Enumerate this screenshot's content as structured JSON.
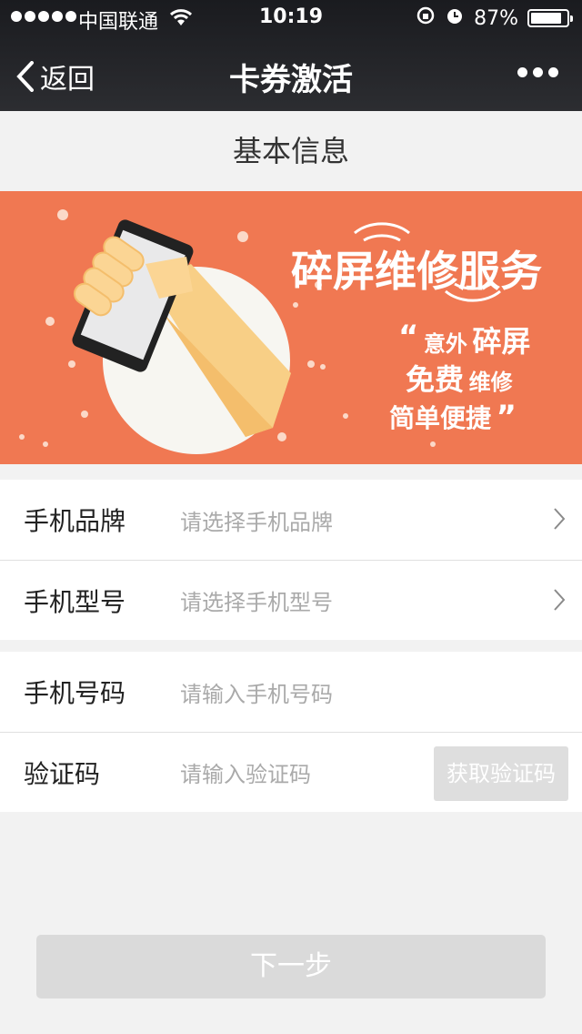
{
  "status_bar": {
    "carrier": "中国联通",
    "time": "10:19",
    "battery": "87%",
    "battery_level": 0.87
  },
  "nav": {
    "back_label": "返回",
    "title": "卡券激活"
  },
  "section_title": "基本信息",
  "banner": {
    "headline": "碎屏维修服务",
    "line1_a": "意外",
    "line1_b": "碎屏",
    "line2_a": "免费",
    "line2_b": "维修",
    "line3": "简单便捷",
    "accent_color": "#f07852"
  },
  "form": {
    "brand": {
      "label": "手机品牌",
      "placeholder": "请选择手机品牌"
    },
    "model": {
      "label": "手机型号",
      "placeholder": "请选择手机型号"
    },
    "phone": {
      "label": "手机号码",
      "placeholder": "请输入手机号码"
    },
    "code": {
      "label": "验证码",
      "placeholder": "请输入验证码",
      "button": "获取验证码"
    }
  },
  "next_button": "下一步"
}
